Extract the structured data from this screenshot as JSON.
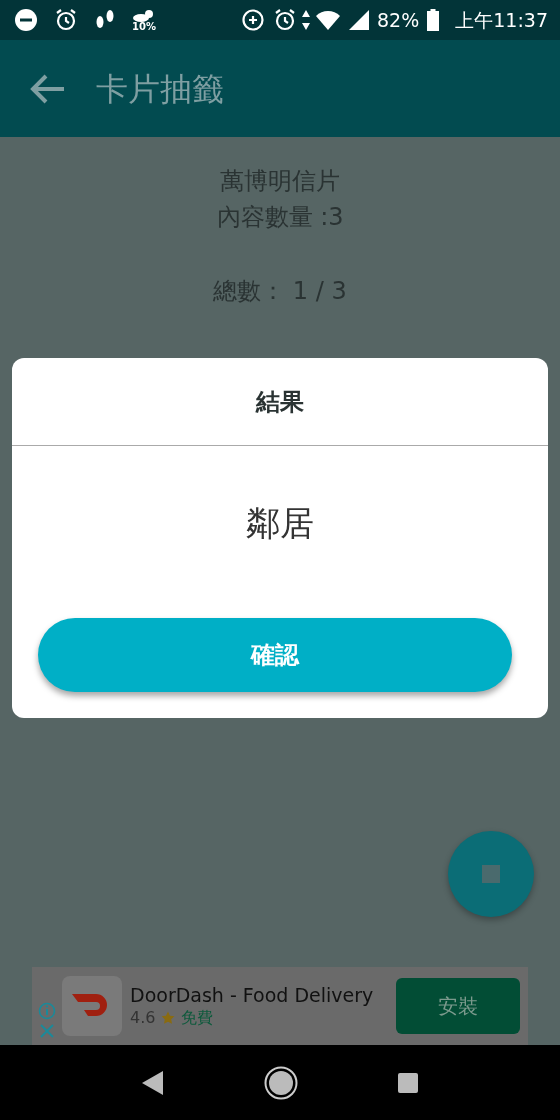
{
  "status_bar": {
    "weather_reading": "10%",
    "battery": "82%",
    "time": "上午11:37"
  },
  "app_bar": {
    "title": "卡片抽籤"
  },
  "content": {
    "deck_name": "萬博明信片",
    "count_line": "內容數量 :3",
    "total": "總數： 1 / 3"
  },
  "dialog": {
    "title": "結果",
    "result": "鄰居",
    "confirm_button": "確認"
  },
  "ad": {
    "app_name": "DoorDash - Food Delivery",
    "rating": "4.6",
    "price": "免費",
    "install_button": "安裝"
  }
}
